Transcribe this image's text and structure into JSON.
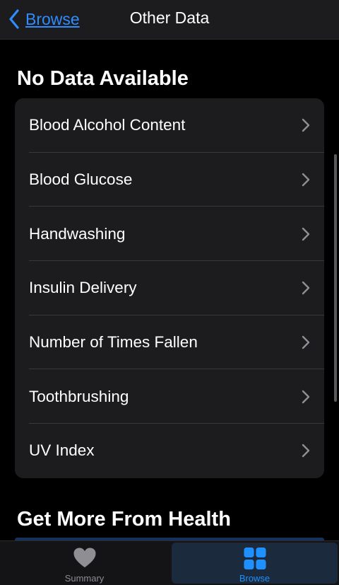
{
  "navbar": {
    "back_label": "Browse",
    "title": "Other Data"
  },
  "sections": {
    "no_data_title": "No Data Available",
    "more_title": "Get More From Health"
  },
  "list": {
    "items": [
      {
        "label": "Blood Alcohol Content"
      },
      {
        "label": "Blood Glucose"
      },
      {
        "label": "Handwashing"
      },
      {
        "label": "Insulin Delivery"
      },
      {
        "label": "Number of Times Fallen"
      },
      {
        "label": "Toothbrushing"
      },
      {
        "label": "UV Index"
      }
    ]
  },
  "tabbar": {
    "tabs": [
      {
        "label": "Summary",
        "icon": "heart-icon",
        "selected": false
      },
      {
        "label": "Browse",
        "icon": "grid-icon",
        "selected": true
      }
    ]
  },
  "colors": {
    "accent": "#2f8cff",
    "background": "#000000",
    "card": "#1c1c1e",
    "inactive_tab": "#8e8e93"
  }
}
